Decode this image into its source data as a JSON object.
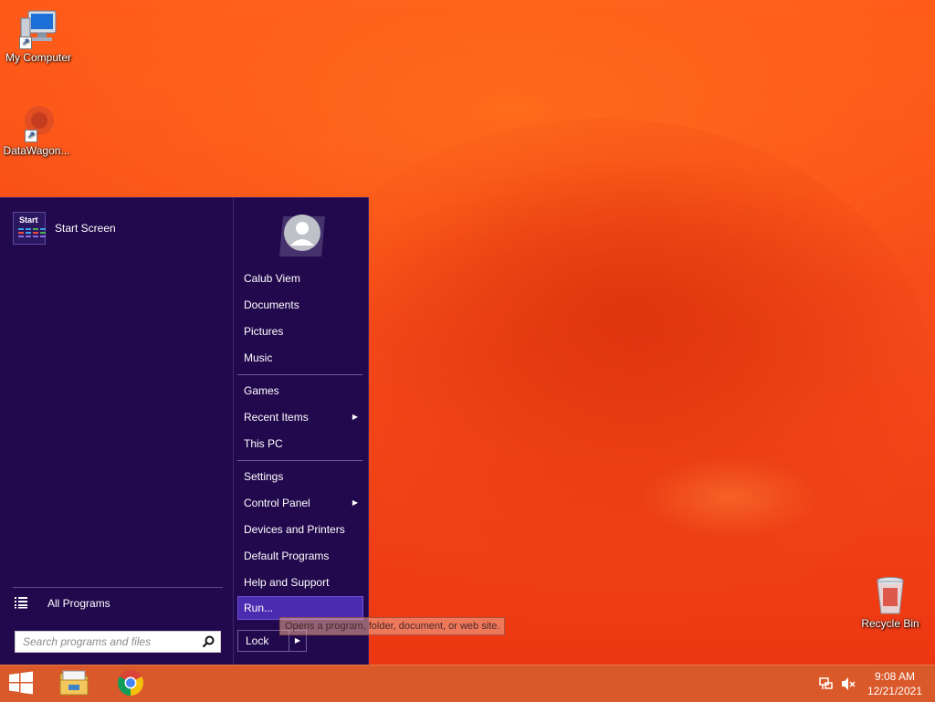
{
  "desktop": {
    "icons": [
      {
        "label": "My Computer",
        "icon": "computer-icon"
      },
      {
        "label": "DataWagon...",
        "icon": "datawagon-icon"
      },
      {
        "label": "Recycle Bin",
        "icon": "recycle-bin-icon"
      }
    ]
  },
  "start_menu": {
    "start_screen": {
      "tile_text": "Start",
      "label": "Start Screen"
    },
    "all_programs": "All Programs",
    "search": {
      "placeholder": "Search programs and files",
      "value": ""
    },
    "items": [
      {
        "label": "Calub Viem"
      },
      {
        "label": "Documents"
      },
      {
        "label": "Pictures"
      },
      {
        "label": "Music"
      },
      {
        "label": "Games"
      },
      {
        "label": "Recent Items",
        "submenu": true
      },
      {
        "label": "This PC"
      },
      {
        "label": "Settings"
      },
      {
        "label": "Control Panel",
        "submenu": true
      },
      {
        "label": "Devices and Printers"
      },
      {
        "label": "Default Programs"
      },
      {
        "label": "Help and Support"
      },
      {
        "label": "Run...",
        "highlighted": true
      }
    ],
    "lock": {
      "label": "Lock",
      "arrow": "▶"
    },
    "submenu_arrow": "▶",
    "tooltip": "Opens a program, folder, document, or web site."
  },
  "taskbar": {
    "pinned": [
      {
        "name": "start-button",
        "icon": "windows-logo-icon"
      },
      {
        "name": "file-explorer",
        "icon": "folder-icon"
      },
      {
        "name": "chrome",
        "icon": "chrome-icon"
      }
    ],
    "tray": {
      "time": "9:08 AM",
      "date": "12/21/2021",
      "icons": [
        "network-icon",
        "volume-muted-icon"
      ]
    }
  },
  "colors": {
    "start_menu_bg": "#22094d",
    "highlight": "#4b2cb0",
    "taskbar": "#d9592a",
    "wallpaper": "#f4481a"
  }
}
